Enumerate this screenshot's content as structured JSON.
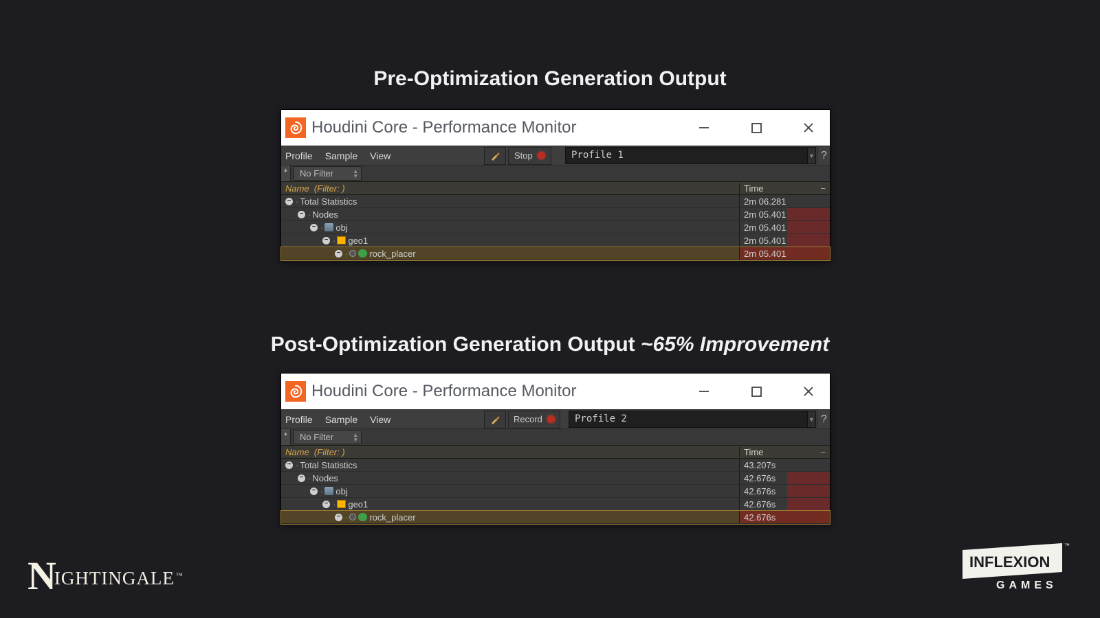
{
  "titles": {
    "pre": "Pre-Optimization Generation Output",
    "post_prefix": "Post-Optimization Generation Output ",
    "post_emph": "~65% Improvement"
  },
  "window_title": "Houdini Core - Performance Monitor",
  "menus": {
    "profile": "Profile",
    "sample": "Sample",
    "view": "View"
  },
  "buttons": {
    "stop": "Stop",
    "record": "Record"
  },
  "profiles": {
    "p1": "Profile 1",
    "p2": "Profile 2"
  },
  "filter": {
    "none": "No Filter"
  },
  "columns": {
    "name": "Name",
    "filter_suffix": "(Filter: )",
    "time": "Time"
  },
  "pre_rows": [
    {
      "indent": 6,
      "label": "Total Statistics",
      "time": "2m 06.281",
      "heat": 0,
      "hl": false,
      "icon": ""
    },
    {
      "indent": 24,
      "label": "Nodes",
      "time": "2m 05.401",
      "heat": 62,
      "hl": false,
      "icon": ""
    },
    {
      "indent": 42,
      "label": "obj",
      "time": "2m 05.401",
      "heat": 62,
      "hl": false,
      "icon": "obj"
    },
    {
      "indent": 60,
      "label": "geo1",
      "time": "2m 05.401",
      "heat": 62,
      "hl": false,
      "icon": "geo"
    },
    {
      "indent": 78,
      "label": "rock_placer",
      "time": "2m 05.401",
      "heat": 0,
      "hl": true,
      "icon": "rock"
    }
  ],
  "post_rows": [
    {
      "indent": 6,
      "label": "Total Statistics",
      "time": "43.207s",
      "heat": 0,
      "hl": false,
      "icon": ""
    },
    {
      "indent": 24,
      "label": "Nodes",
      "time": "42.676s",
      "heat": 62,
      "hl": false,
      "icon": ""
    },
    {
      "indent": 42,
      "label": "obj",
      "time": "42.676s",
      "heat": 62,
      "hl": false,
      "icon": "obj"
    },
    {
      "indent": 60,
      "label": "geo1",
      "time": "42.676s",
      "heat": 62,
      "hl": false,
      "icon": "geo"
    },
    {
      "indent": 78,
      "label": "rock_placer",
      "time": "42.676s",
      "heat": 0,
      "hl": true,
      "icon": "rock"
    }
  ],
  "logos": {
    "left": "Nightingale",
    "right_top": "INFLEXION",
    "right_bottom": "GAMES"
  }
}
